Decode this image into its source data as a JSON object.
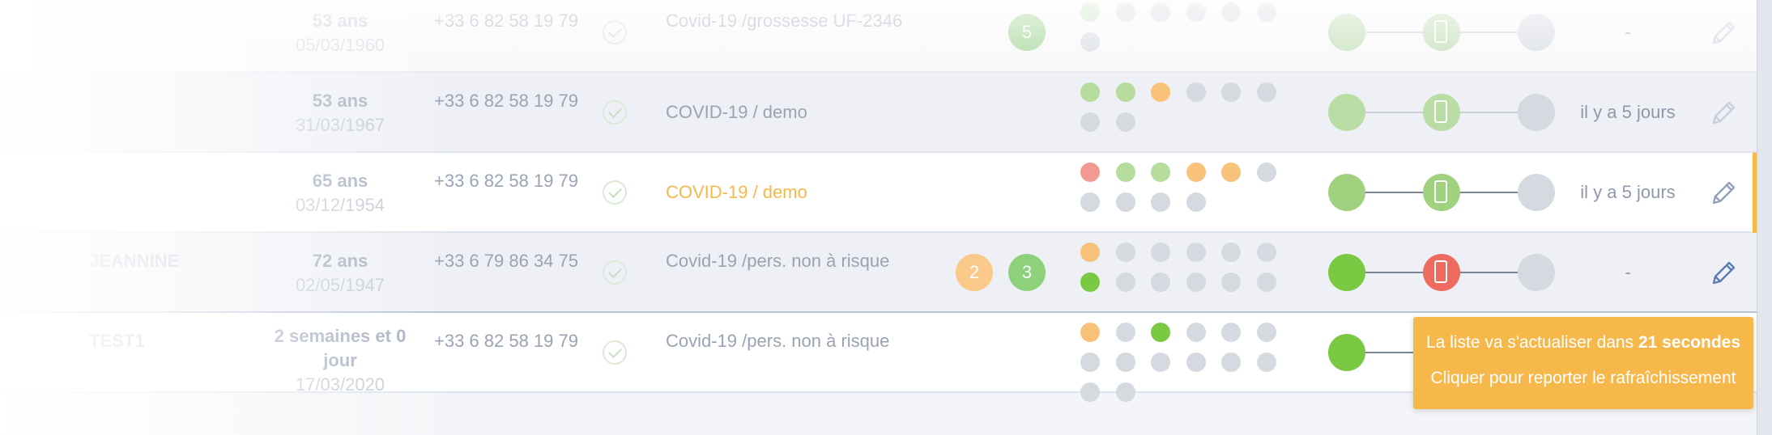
{
  "colors": {
    "green": "#7ac943",
    "light_green": "#a8d98a",
    "orange": "#f7b84b",
    "red": "#ee6b5f",
    "grey": "#d5d9e0",
    "toast": "#f7b84b"
  },
  "rows": [
    {
      "name": "",
      "name_sub": "",
      "age": "53 ans",
      "date": "05/03/1960",
      "phone": "+33 6 82 58 19 79",
      "protocol": "Covid-19 /grossesse UF-2346",
      "badges": [
        {
          "value": "5",
          "color": "green"
        }
      ],
      "dots": [
        "light_green",
        "grey",
        "grey",
        "grey",
        "grey",
        "grey",
        "grey"
      ],
      "nodes": [
        "light_green",
        "light_green",
        "grey"
      ],
      "last": "-"
    },
    {
      "name": "",
      "name_sub": "",
      "age": "53 ans",
      "date": "31/03/1967",
      "phone": "+33 6 82 58 19 79",
      "protocol": "COVID-19 / demo",
      "badges": [],
      "dots": [
        "green",
        "green",
        "orange",
        "grey",
        "grey",
        "grey",
        "grey",
        "grey"
      ],
      "nodes": [
        "green",
        "green",
        "grey"
      ],
      "last": "il y a 5 jours"
    },
    {
      "name": "",
      "name_sub": "",
      "age": "65 ans",
      "date": "03/12/1954",
      "phone": "+33 6 82 58 19 79",
      "protocol": "COVID-19 / demo",
      "badges": [],
      "dots": [
        "red",
        "green",
        "green",
        "orange",
        "orange",
        "grey",
        "grey",
        "grey",
        "grey",
        "grey"
      ],
      "nodes": [
        "green",
        "green",
        "grey"
      ],
      "last": "il y a 5 jours"
    },
    {
      "name": "JEANNINE",
      "name_sub": "",
      "age": "72 ans",
      "date": "02/05/1947",
      "phone": "+33 6 79 86 34 75",
      "protocol": "Covid-19 /pers. non à risque",
      "badges": [
        {
          "value": "2",
          "color": "orange"
        },
        {
          "value": "3",
          "color": "green"
        }
      ],
      "dots": [
        "orange",
        "grey",
        "grey",
        "grey",
        "grey",
        "grey",
        "green",
        "grey",
        "grey",
        "grey",
        "grey",
        "grey"
      ],
      "nodes": [
        "green",
        "red",
        "grey"
      ],
      "last": "-"
    },
    {
      "name": "TEST1",
      "name_sub": "",
      "age": "2 semaines et 0 jour",
      "date": "17/03/2020",
      "phone": "+33 6 82 58 19 79",
      "protocol": "Covid-19 /pers. non à risque",
      "badges": [],
      "dots": [
        "orange",
        "grey",
        "green",
        "grey",
        "grey",
        "grey",
        "grey",
        "grey",
        "grey",
        "grey",
        "grey",
        "grey",
        "grey",
        "grey"
      ],
      "nodes": [
        "green",
        "green",
        "grey"
      ],
      "last": "-"
    }
  ],
  "toast": {
    "line1_prefix": "La liste va s'actualiser dans ",
    "line1_bold": "21 secondes",
    "line2": "Cliquer pour reporter le rafraîchissement"
  }
}
